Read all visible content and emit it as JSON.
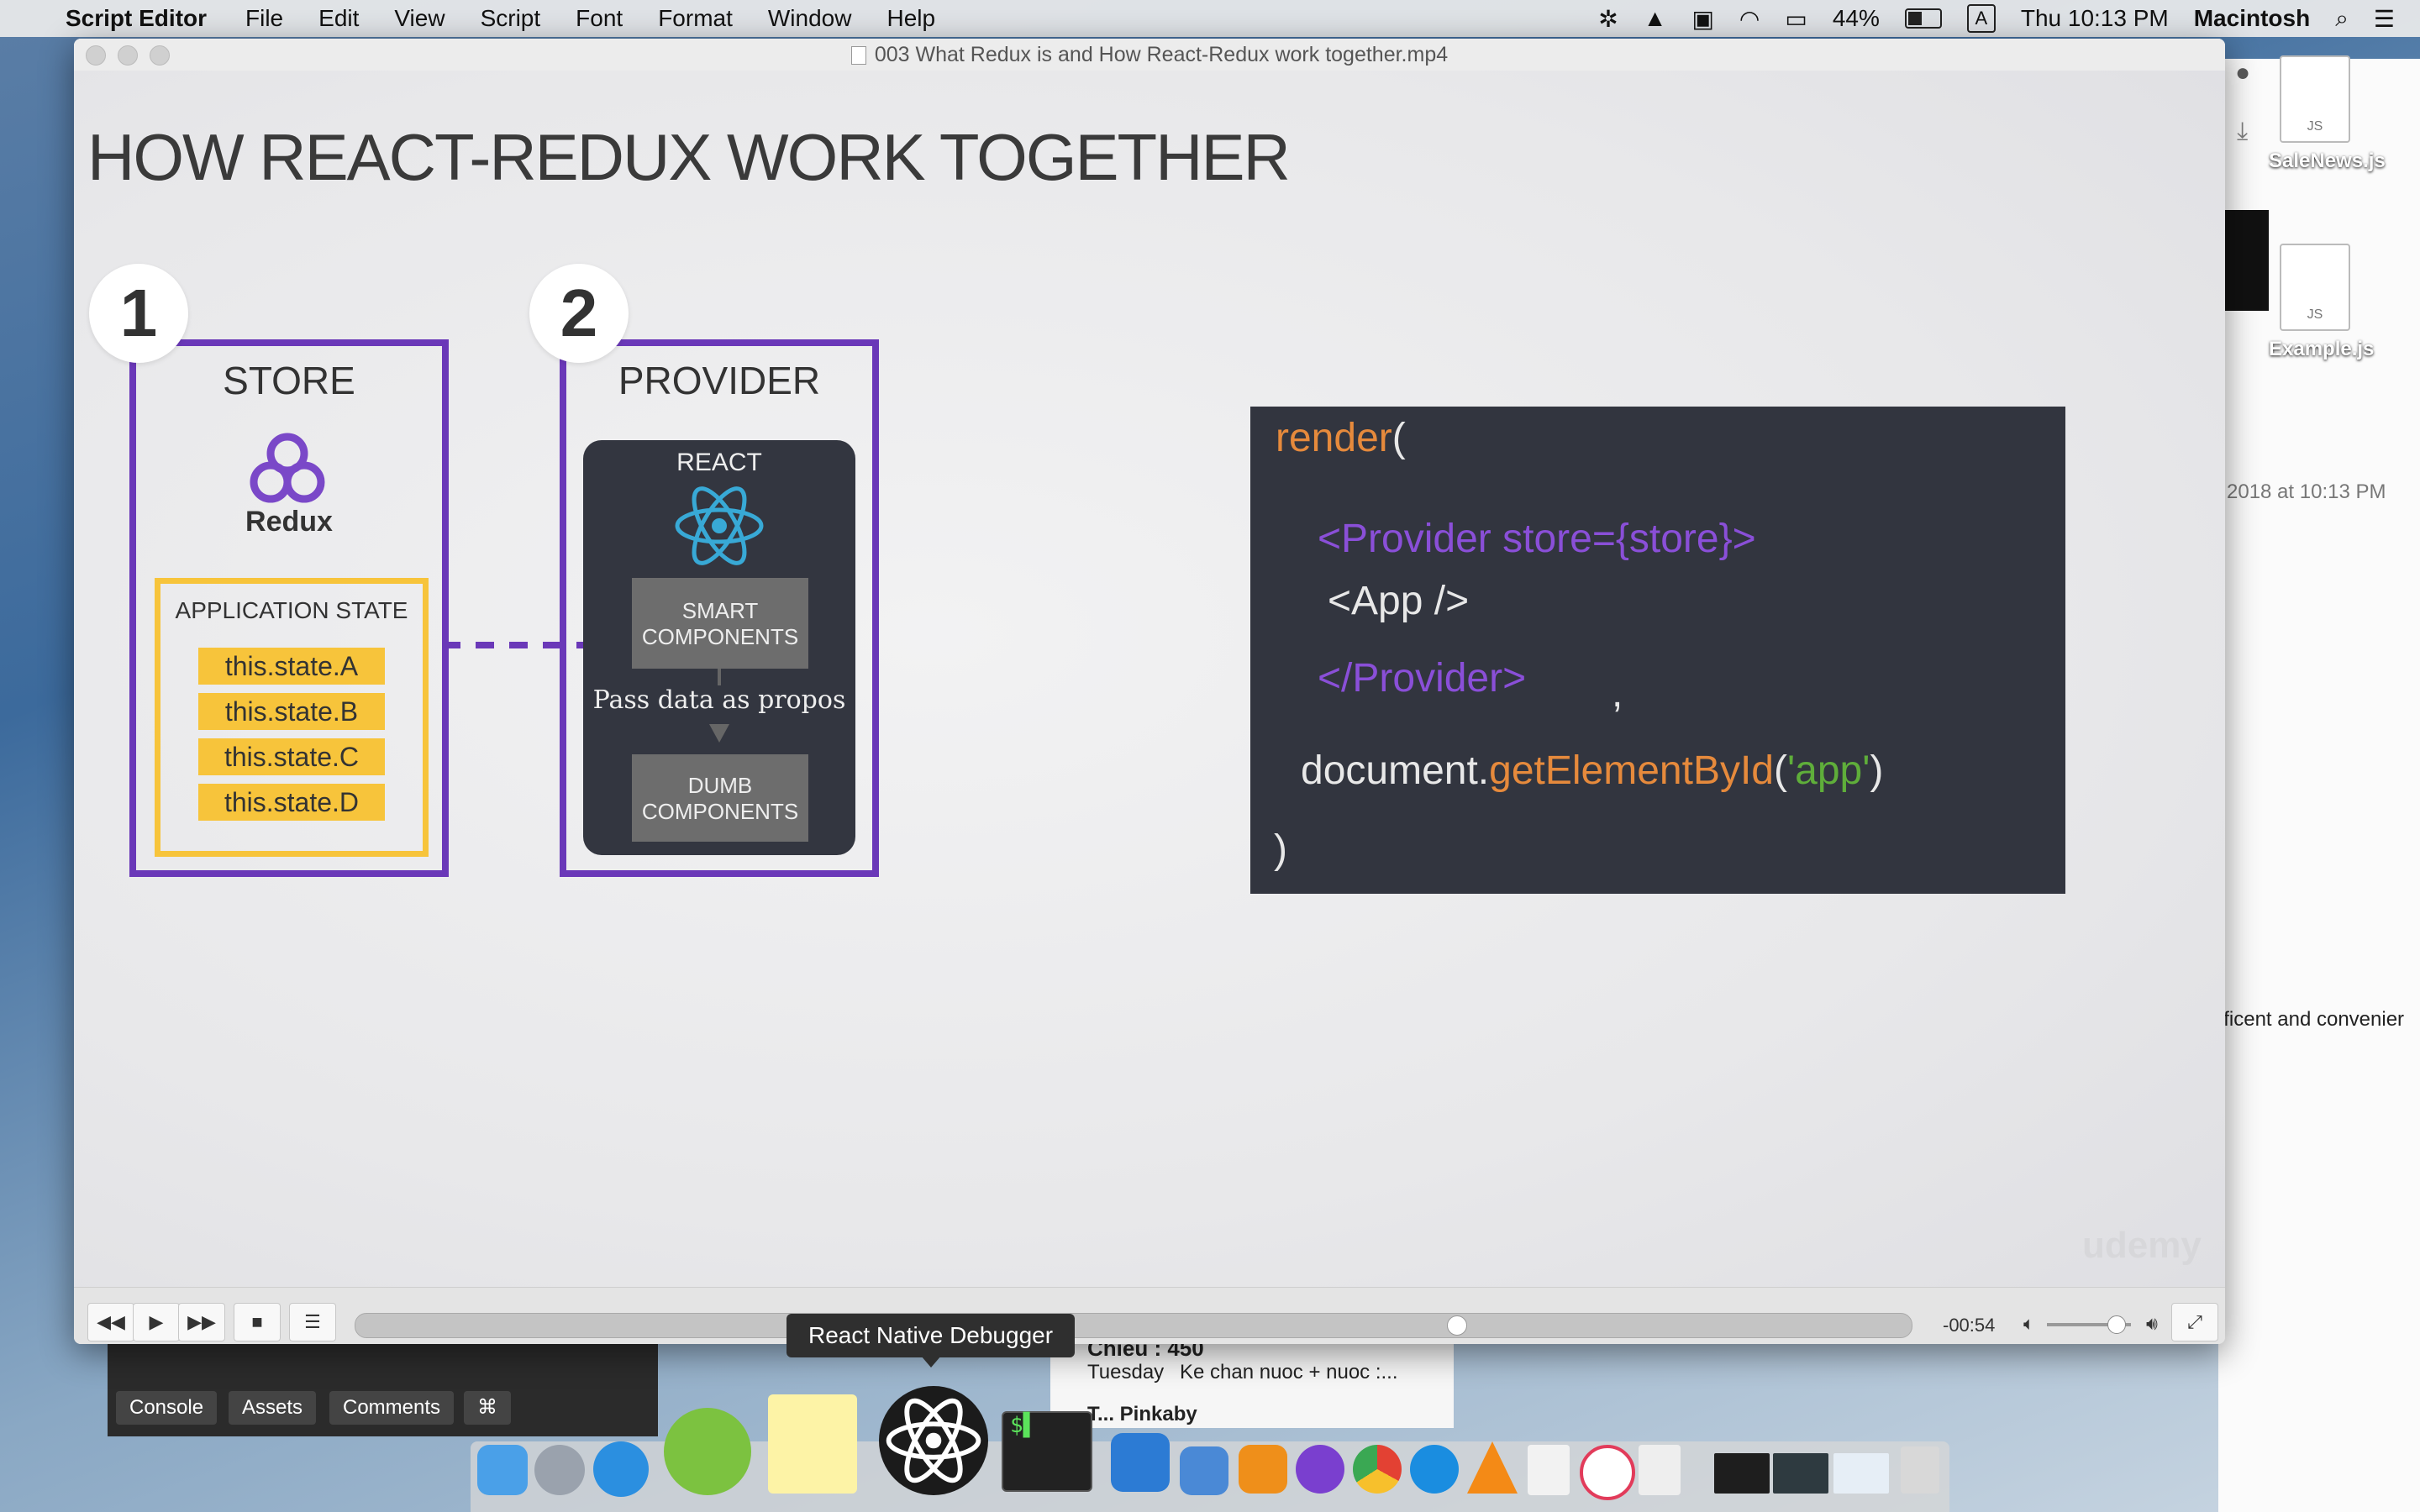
{
  "menubar": {
    "apple": "",
    "app_name": "Script Editor",
    "menus": [
      "File",
      "Edit",
      "View",
      "Script",
      "Font",
      "Format",
      "Window",
      "Help"
    ],
    "battery": "44%",
    "input_source": "A",
    "clock": "Thu 10:13 PM",
    "user": "Macintosh"
  },
  "desktop": {
    "files": [
      {
        "name": "SaleNews.js",
        "badge": "JS"
      },
      {
        "name": "Example.js",
        "badge": "JS"
      }
    ],
    "bg_window_text": "2018 at 10:13 PM",
    "bg_window_snippet": "fficent and convenier"
  },
  "player": {
    "window_title": "003 What Redux is and How React-Redux work together.mp4",
    "slide": {
      "title": "HOW REACT-REDUX WORK TOGETHER",
      "step1": {
        "number": "1",
        "title": "STORE",
        "logo": "Redux",
        "app_state_label": "APPLICATION STATE",
        "states": [
          "this.state.A",
          "this.state.B",
          "this.state.C",
          "this.state.D"
        ]
      },
      "step2": {
        "number": "2",
        "title": "PROVIDER",
        "react_label": "REACT",
        "smart_line1": "SMART",
        "smart_line2": "COMPONENTS",
        "pass_label": "Pass data as propos",
        "dumb_line1": "DUMB",
        "dumb_line2": "COMPONENTS"
      },
      "code": {
        "l1_fn": "render",
        "l1_paren": "(",
        "l2": "<Provider store={store}>",
        "l3": "<App />",
        "l4": "</Provider>",
        "l4_comma": ",",
        "l5_obj": "document.",
        "l5_method": "getElementById",
        "l5_open": "(",
        "l5_arg": "'app'",
        "l5_close": ")",
        "l6": ")"
      },
      "watermark": "udemy"
    },
    "controls": {
      "rewind": "◀◀",
      "play": "▶",
      "forward": "▶▶",
      "stop": "■",
      "playlist": "☰",
      "progress_fraction": 0.71,
      "time_remaining": "-00:54",
      "volume_fraction": 0.9,
      "fullscreen": "⤢"
    }
  },
  "tooltip": "React Native Debugger",
  "bottom_app": {
    "tabs": [
      "Console",
      "Assets",
      "Comments",
      "⌘"
    ]
  },
  "messages": {
    "sender": "Chieu : 450",
    "day": "Tuesday",
    "preview": "Ke chan nuoc + nuoc :...",
    "next_sender": "T... Pinkaby"
  },
  "colors": {
    "purple": "#6a38b8",
    "yellow": "#f7c43b",
    "code_bg": "#32353f",
    "code_orange": "#e68a3c",
    "code_purple": "#8a4fd8",
    "code_green": "#5fae3a",
    "react_blue": "#38a9d6"
  }
}
